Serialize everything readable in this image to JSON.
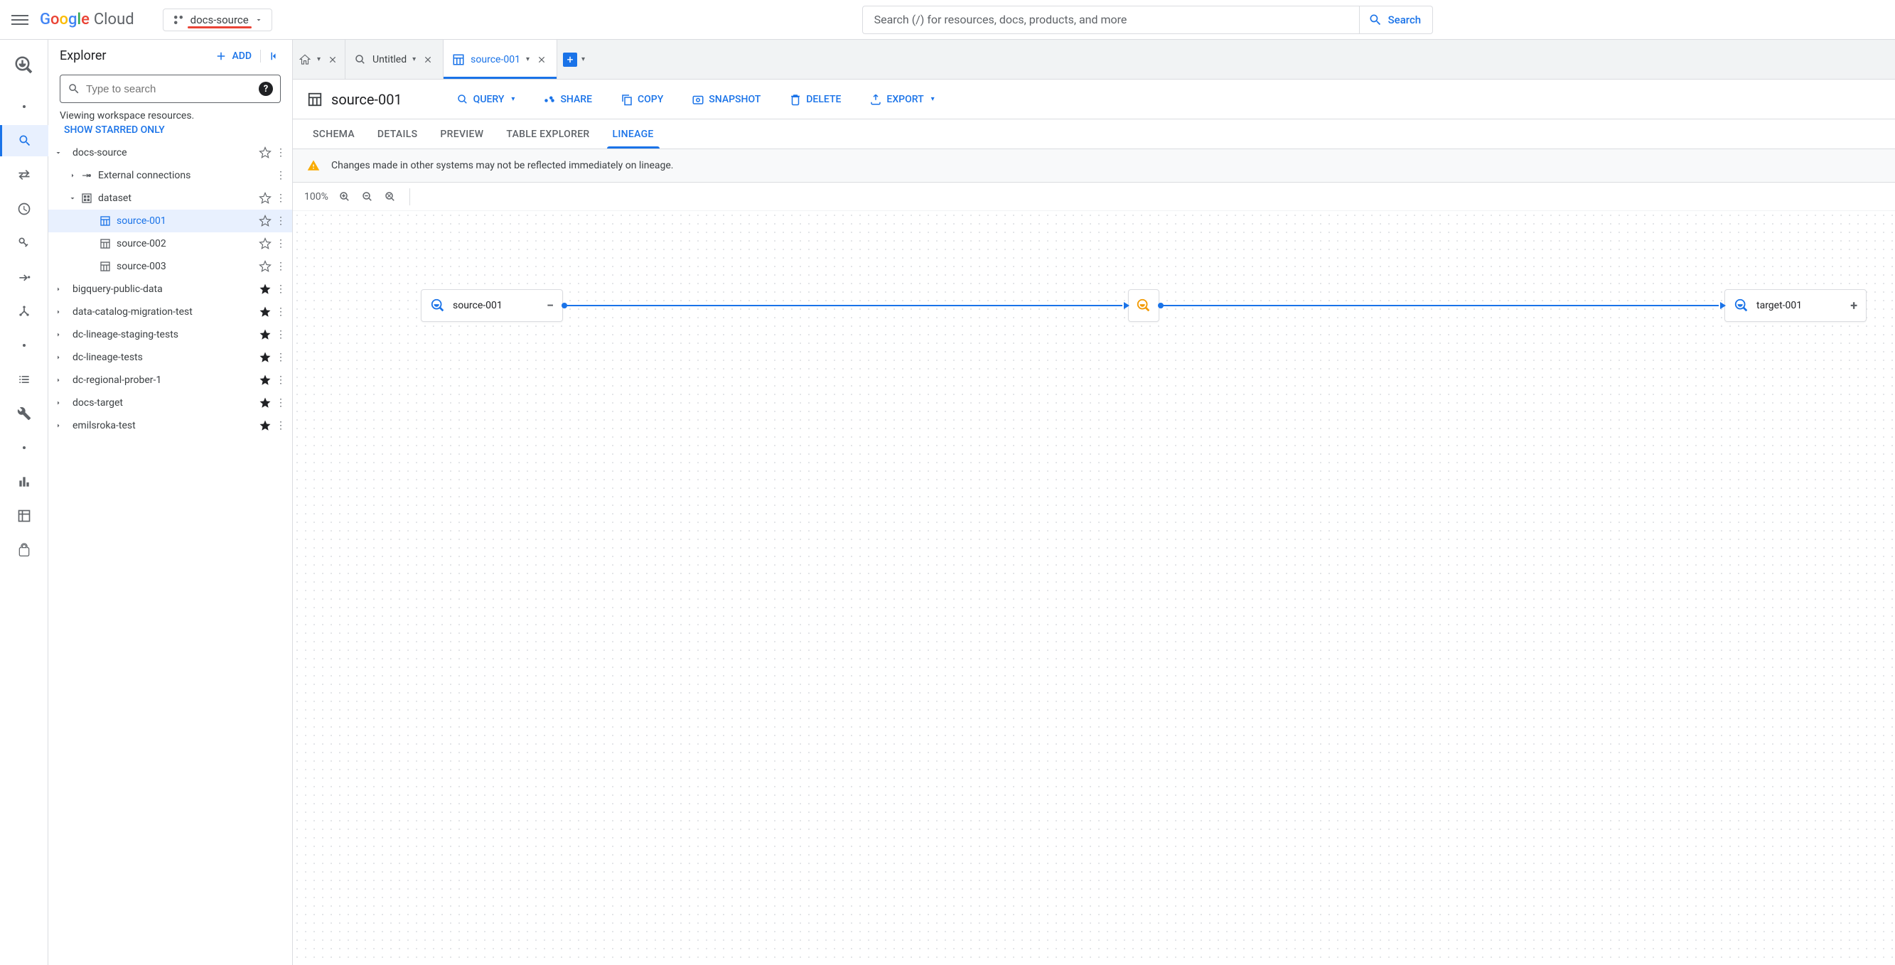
{
  "topbar": {
    "logo_cloud": "Cloud",
    "project_name": "docs-source",
    "search_placeholder": "Search (/) for resources, docs, products, and more",
    "search_button": "Search"
  },
  "explorer": {
    "title": "Explorer",
    "add_button": "ADD",
    "search_placeholder": "Type to search",
    "viewing_text": "Viewing workspace resources.",
    "show_starred": "SHOW STARRED ONLY",
    "tree": {
      "project": "docs-source",
      "external": "External connections",
      "dataset": "dataset",
      "tables": [
        "source-001",
        "source-002",
        "source-003"
      ],
      "other_projects": [
        "bigquery-public-data",
        "data-catalog-migration-test",
        "dc-lineage-staging-tests",
        "dc-lineage-tests",
        "dc-regional-prober-1",
        "docs-target",
        "emilsroka-test"
      ]
    }
  },
  "tabs": {
    "untitled": "Untitled",
    "active": "source-001"
  },
  "table_header": {
    "title": "source-001",
    "actions": {
      "query": "QUERY",
      "share": "SHARE",
      "copy": "COPY",
      "snapshot": "SNAPSHOT",
      "delete": "DELETE",
      "export": "EXPORT"
    }
  },
  "subtabs": {
    "schema": "SCHEMA",
    "details": "DETAILS",
    "preview": "PREVIEW",
    "table_explorer": "TABLE EXPLORER",
    "lineage": "LINEAGE"
  },
  "warning": "Changes made in other systems may not be reflected immediately on lineage.",
  "zoom": {
    "level": "100%"
  },
  "lineage": {
    "source": "source-001",
    "target": "target-001"
  }
}
